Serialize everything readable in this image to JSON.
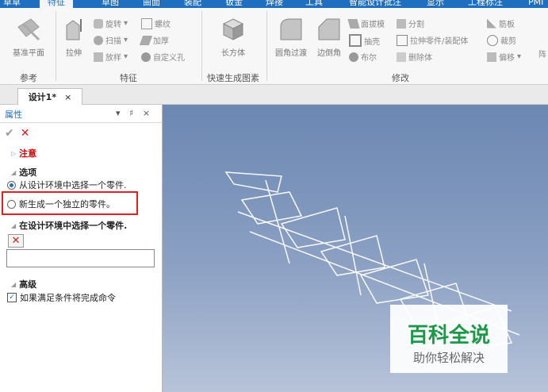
{
  "ribbon_tabs": [
    "草草",
    "特征",
    "草图",
    "曲面",
    "装配",
    "钣金",
    "焊接",
    "工具",
    "智能设计批注",
    "显示",
    "工程标注",
    "PMI"
  ],
  "active_tab_index": 1,
  "ribbon": {
    "ref_plane": "基准平面",
    "extrude": "拉伸",
    "revolve": "旋转",
    "sweep": "扫描",
    "loft": "放样",
    "thread": "螺纹",
    "thicken": "加厚",
    "custom_hole": "自定义孔",
    "box": "长方体",
    "fillet": "圆角过渡",
    "chamfer": "边倒角",
    "draft": "面拔模",
    "shell": "抽壳",
    "boolean": "布尔",
    "split": "分割",
    "extrude_to_part": "拉伸零件/装配体",
    "delete_body": "删除体",
    "rib": "筋板",
    "trim": "裁剪",
    "offset": "偏移",
    "array_partial": "阵",
    "groups": {
      "reference": "参考",
      "feature": "特征",
      "quick_gen": "快速生成图素",
      "modify": "修改"
    }
  },
  "document_tab": "设计1*",
  "document_tab_close": "×",
  "panel": {
    "title": "属性",
    "header_controls": "▾ ♯ ×",
    "ok": "✔",
    "cancel": "✕",
    "note": "注意",
    "options": "选项",
    "option1": "从设计环境中选择一个零件.",
    "option2": "新生成一个独立的零件。",
    "select_section": "在设计环境中选择一个零件.",
    "advanced": "高级",
    "complete_cmd": "如果满足条件将完成命令"
  },
  "watermark": {
    "title": "百科全说",
    "subtitle": "助你轻松解决"
  },
  "colors": {
    "accent": "#1e6fbf",
    "highlight_box": "#e02020",
    "cancel_red": "#d42020"
  }
}
